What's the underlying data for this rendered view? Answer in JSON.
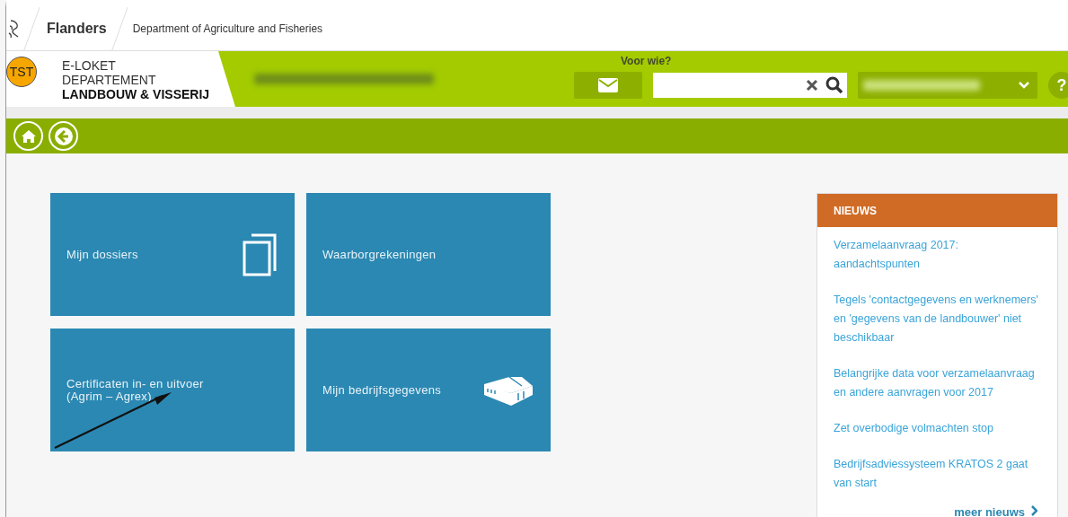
{
  "header": {
    "brand": "Flanders",
    "department": "Department of Agriculture and Fisheries"
  },
  "app": {
    "badge": "TST",
    "title_lines": [
      "E-LOKET",
      "DEPARTEMENT",
      "LANDBOUW & VISSERIJ"
    ],
    "search_label": "Voor wie?",
    "help": "?"
  },
  "tiles": [
    {
      "label": "Mijn dossiers",
      "kind": "documents"
    },
    {
      "label": "Waarborgrekeningen",
      "kind": "plain"
    },
    {
      "label": "Certificaten in- en uitvoer\n(Agrim – Agrex)",
      "kind": "plain"
    },
    {
      "label": "Mijn bedrijfsgegevens",
      "kind": "building"
    }
  ],
  "news": {
    "title": "NIEUWS",
    "items": [
      "Verzamelaanvraag 2017: aandachtspunten",
      "Tegels 'contactgegevens en werknemers' en 'gegevens van de landbouwer' niet beschikbaar",
      "Belangrijke data voor verzamelaanvraag en andere aanvragen voor 2017",
      "Zet overbodige volmachten stop",
      "Bedrijfsadviessysteem KRATOS 2 gaat van start"
    ],
    "more": "meer nieuws"
  }
}
